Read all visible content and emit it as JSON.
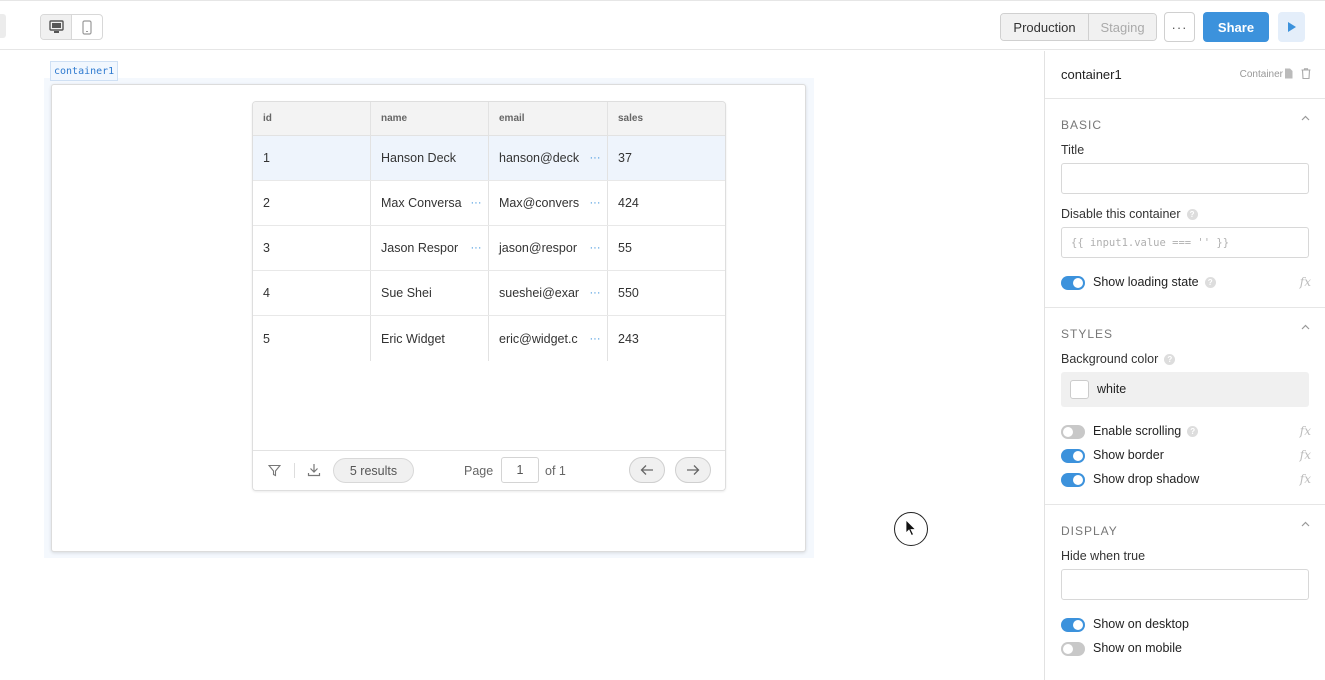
{
  "toolbar": {
    "env_production": "Production",
    "env_staging": "Staging",
    "more_label": "···",
    "share_label": "Share",
    "devices": [
      "desktop-icon",
      "mobile-icon"
    ]
  },
  "canvas": {
    "container_tag": "container1",
    "table": {
      "columns": [
        "id",
        "name",
        "email",
        "sales"
      ],
      "rows": [
        {
          "id": "1",
          "name": "Hanson Deck",
          "email": "hanson@deck",
          "sales": "37"
        },
        {
          "id": "2",
          "name": "Max Conversa",
          "email": "Max@convers",
          "sales": "424"
        },
        {
          "id": "3",
          "name": "Jason Respor",
          "email": "jason@respor",
          "sales": "55"
        },
        {
          "id": "4",
          "name": "Sue Shei",
          "email": "sueshei@exar",
          "sales": "550"
        },
        {
          "id": "5",
          "name": "Eric Widget",
          "email": "eric@widget.c",
          "sales": "243"
        }
      ],
      "footer": {
        "results": "5 results",
        "page_label": "Page",
        "page_value": "1",
        "of_label": "of 1"
      }
    }
  },
  "panel": {
    "title": "container1",
    "type": "Container",
    "basic": {
      "heading": "BASIC",
      "title_label": "Title",
      "title_value": "",
      "disable_label": "Disable this container",
      "disable_placeholder": "{{ input1.value === '' }}",
      "show_loading": "Show loading state"
    },
    "styles": {
      "heading": "STYLES",
      "bg_label": "Background color",
      "bg_value": "white",
      "enable_scrolling": "Enable scrolling",
      "show_border": "Show border",
      "show_shadow": "Show drop shadow"
    },
    "display": {
      "heading": "DISPLAY",
      "hide_label": "Hide when true",
      "hide_value": "",
      "show_desktop": "Show on desktop",
      "show_mobile": "Show on mobile"
    },
    "fx_label": "fx"
  },
  "colors": {
    "accent": "#3c92dc",
    "toggle_off": "#c8c8c8"
  }
}
